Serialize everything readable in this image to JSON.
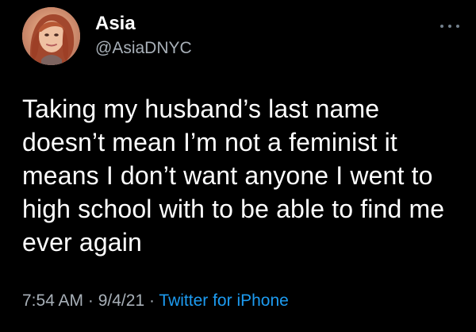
{
  "user": {
    "name": "Asia",
    "handle": "@AsiaDNYC",
    "avatar_icon": "profile-photo-icon",
    "more_icon": "more-options-icon"
  },
  "tweet": {
    "lines": [
      "Taking my husband’s last name",
      "doesn’t mean I’m not a feminist it",
      "means I don’t want anyone I went to",
      "high school with to be able to find me",
      "ever again"
    ]
  },
  "meta": {
    "time": "7:54 AM",
    "separator_1": " · ",
    "date": "9/4/21",
    "separator_2": " · ",
    "source": "Twitter for iPhone"
  },
  "colors": {
    "background": "#000000",
    "text_primary": "#ffffff",
    "text_secondary": "#a8b0b8",
    "accent": "#1d9bf0"
  }
}
